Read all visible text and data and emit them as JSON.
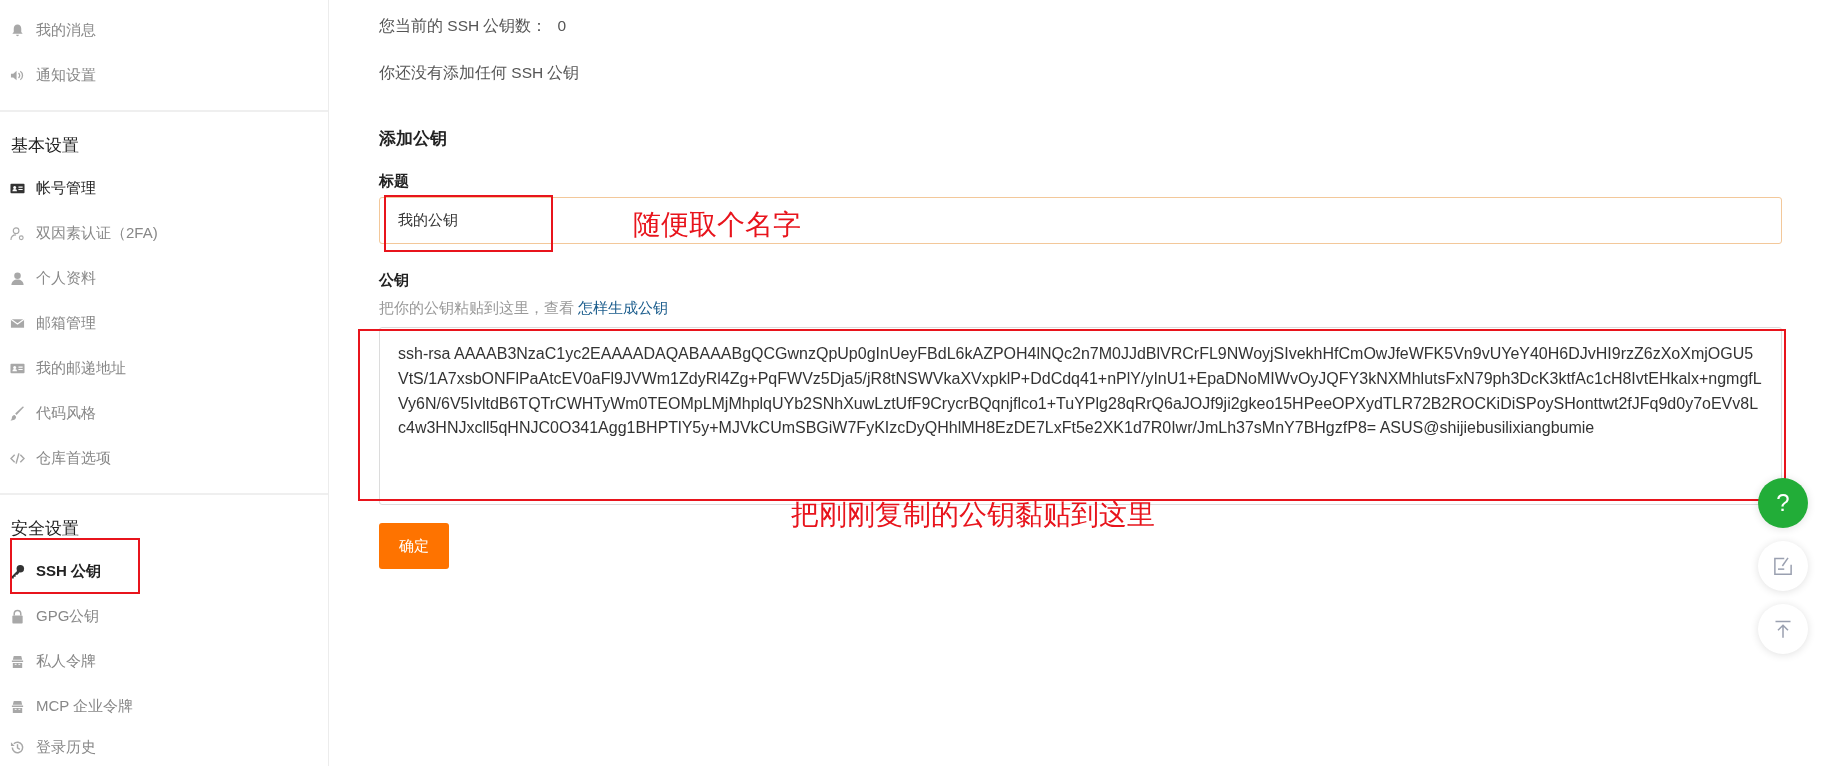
{
  "sidebar": {
    "groups": [
      {
        "items": [
          {
            "label": "我的消息",
            "selected": false,
            "highlighted": false,
            "annotated": false
          },
          {
            "label": "通知设置",
            "selected": false,
            "highlighted": false,
            "annotated": false
          }
        ]
      },
      {
        "heading": "基本设置",
        "items": [
          {
            "label": "帐号管理",
            "selected": false,
            "highlighted": true,
            "annotated": false
          },
          {
            "label": "双因素认证（2FA)",
            "selected": false,
            "highlighted": false,
            "annotated": false
          },
          {
            "label": "个人资料",
            "selected": false,
            "highlighted": false,
            "annotated": false
          },
          {
            "label": "邮箱管理",
            "selected": false,
            "highlighted": false,
            "annotated": false
          },
          {
            "label": "我的邮递地址",
            "selected": false,
            "highlighted": false,
            "annotated": false
          },
          {
            "label": "代码风格",
            "selected": false,
            "highlighted": false,
            "annotated": false
          },
          {
            "label": "仓库首选项",
            "selected": false,
            "highlighted": false,
            "annotated": false
          }
        ]
      },
      {
        "heading": "安全设置",
        "items": [
          {
            "label": "SSH 公钥",
            "selected": true,
            "highlighted": false,
            "annotated": true
          },
          {
            "label": "GPG公钥",
            "selected": false,
            "highlighted": false,
            "annotated": false
          },
          {
            "label": "私人令牌",
            "selected": false,
            "highlighted": false,
            "annotated": false
          },
          {
            "label": "MCP 企业令牌",
            "selected": false,
            "highlighted": false,
            "annotated": false
          },
          {
            "label": "登录历史",
            "selected": false,
            "highlighted": false,
            "annotated": false
          }
        ]
      }
    ]
  },
  "main": {
    "key_count_label": "您当前的 SSH 公钥数：",
    "key_count": "0",
    "empty_message": "你还没有添加任何 SSH 公钥",
    "form": {
      "heading": "添加公钥",
      "title_field": {
        "label": "标题",
        "value": "我的公钥",
        "annotated": true,
        "note": "随便取个名字"
      },
      "key_field": {
        "label": "公钥",
        "hint": "把你的公钥粘贴到这里，查看",
        "hint_link": "怎样生成公钥",
        "value": "ssh-rsa AAAAB3NzaC1yc2EAAAADAQABAAABgQCGwnzQpUp0gInUeyFBdL6kAZPOH4lNQc2n7M0JJdBlVRCrFL9NWoyjSIvekhHfCmOwJfeWFK5Vn9vUYeY40H6DJvHI9rzZ6zXoXmjOGU5VtS/1A7xsbONFlPaAtcEV0aFl9JVWm1ZdyRl4Zg+PqFWVz5Dja5/jR8tNSWVkaXVxpklP+DdCdq41+nPlY/yInU1+EpaDNoMIWvOyJQFY3kNXMhlutsFxN79ph3DcK3ktfAc1cH8IvtEHkalx+ngmgfLVy6N/6V5IvltdB6TQTrCWHTyWm0TEOMpLMjMhplqUYb2SNhXuwLztUfF9CrycrBQqnjflco1+TuYPlg28qRrQ6aJOJf9ji2gkeo15HPeeOPXydTLR72B2ROCKiDiSPoySHonttwt2fJFq9d0y7oEVv8Lc4w3HNJxcll5qHNJC0O341Agg1BHPTlY5y+MJVkCUmSBGiW7FyKIzcDyQHhlMH8EzDE7LxFt5e2XK1d7R0Iwr/JmLh37sMnY7BHgzfP8= ASUS@shijiebusilixiangbumie",
        "annotated": true,
        "note": "把刚刚复制的公钥黏贴到这里"
      },
      "submit": "确定"
    }
  },
  "floating": {
    "help": "?"
  }
}
